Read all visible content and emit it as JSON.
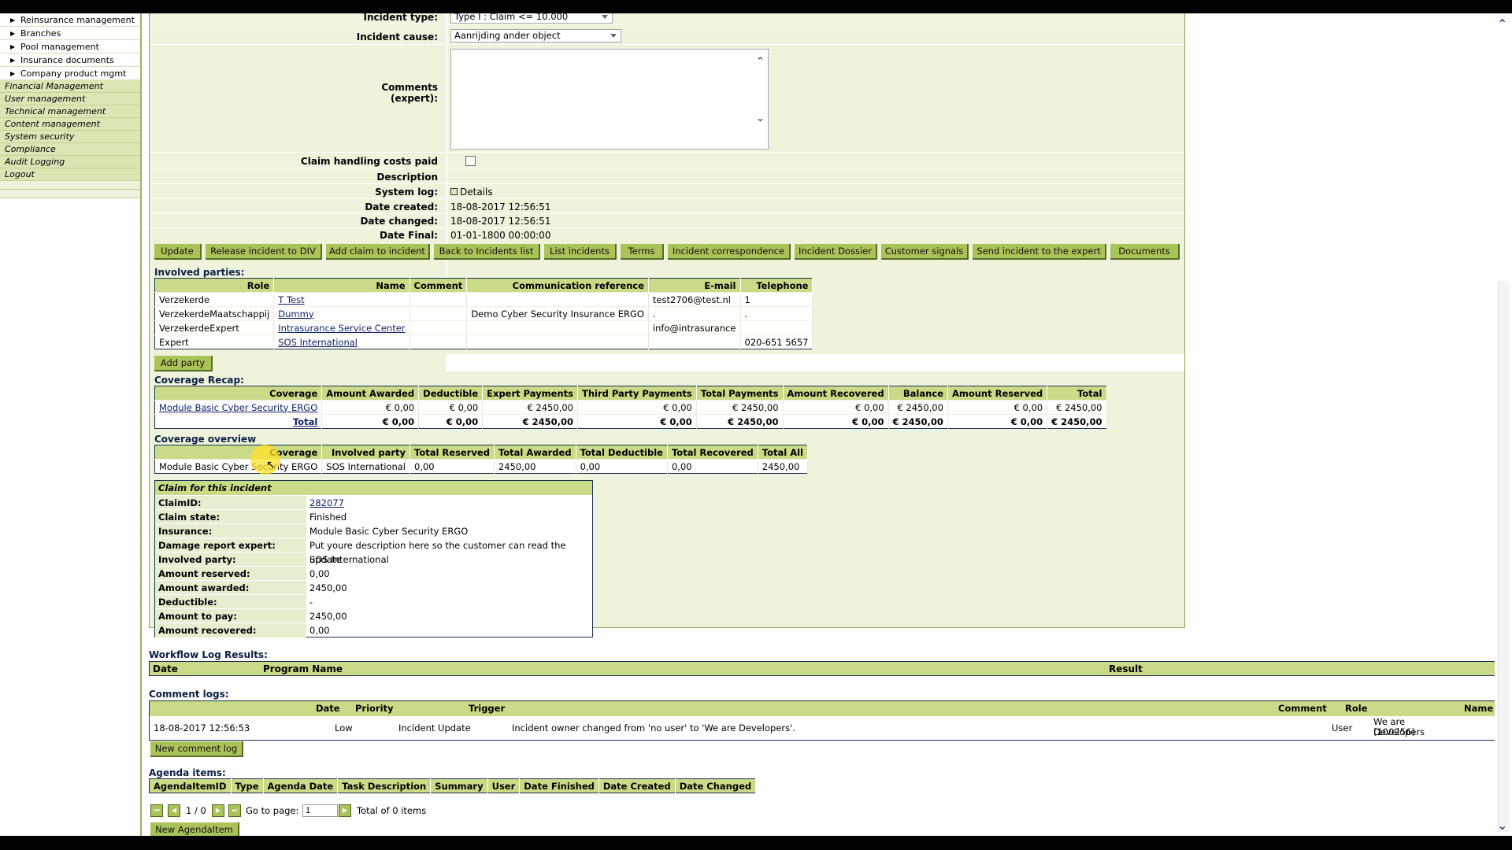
{
  "sidebar": {
    "sub_items": [
      "Reinsurance management",
      "Branches",
      "Pool management",
      "Insurance documents",
      "Company product mgmt"
    ],
    "main_items": [
      "Financial Management",
      "User management",
      "Technical management",
      "Content management",
      "System security",
      "Compliance",
      "Audit Logging",
      "Logout"
    ]
  },
  "form": {
    "incident_type_label": "Incident type:",
    "incident_type_value": "Type I : Claim <= 10.000",
    "incident_cause_label": "Incident cause:",
    "incident_cause_value": "Aanrijding ander object",
    "comments_label_1": "Comments",
    "comments_label_2": "(expert):",
    "claim_costs_label": "Claim handling costs paid",
    "description_label": "Description",
    "system_log_label": "System log:",
    "system_log_value": "Details",
    "date_created_label": "Date created:",
    "date_created_value": "18-08-2017 12:56:51",
    "date_changed_label": "Date changed:",
    "date_changed_value": "18-08-2017 12:56:51",
    "date_final_label": "Date Final:",
    "date_final_value": "01-01-1800 00:00:00"
  },
  "buttons": [
    "Update",
    "Release incident to DIV",
    "Add claim to incident",
    "Back to Incidents list",
    "List incidents",
    "Terms",
    "Incident correspondence",
    "Incident Dossier",
    "Customer signals",
    "Send incident to the expert",
    "Documents"
  ],
  "involved_parties": {
    "title": "Involved parties:",
    "headers": [
      "Role",
      "Name",
      "Comment",
      "Communication reference",
      "E-mail",
      "Telephone"
    ],
    "rows": [
      [
        "Verzekerde",
        "T Test",
        "",
        "",
        "test2706@test.nl",
        "1"
      ],
      [
        "VerzekerdeMaatschappij",
        "Dummy",
        "",
        "Demo Cyber Security Insurance ERGO",
        ".",
        "."
      ],
      [
        "VerzekerdeExpert",
        "Intrasurance Service Center",
        "",
        "",
        "info@intrasurance",
        ""
      ],
      [
        "Expert",
        "SOS International",
        "",
        "",
        "",
        "020-651 5657"
      ]
    ],
    "add_button": "Add party"
  },
  "coverage_recap": {
    "title": "Coverage Recap:",
    "headers": [
      "Coverage",
      "Amount Awarded",
      "Deductible",
      "Expert Payments",
      "Third Party Payments",
      "Total Payments",
      "Amount Recovered",
      "Balance",
      "Amount Reserved",
      "Total"
    ],
    "rows": [
      [
        "Module Basic Cyber Security ERGO",
        "€ 0,00",
        "€ 0,00",
        "€ 2450,00",
        "€ 0,00",
        "€ 2450,00",
        "€ 0,00",
        "€ 2450,00",
        "€ 0,00",
        "€ 2450,00"
      ]
    ],
    "total_row": [
      "Total",
      "€ 0,00",
      "€ 0,00",
      "€ 2450,00",
      "€ 0,00",
      "€ 2450,00",
      "€ 0,00",
      "€ 2450,00",
      "€ 0,00",
      "€ 2450,00"
    ]
  },
  "coverage_overview": {
    "title": "Coverage overview",
    "headers": [
      "Coverage",
      "Involved party",
      "Total Reserved",
      "Total Awarded",
      "Total Deductible",
      "Total Recovered",
      "Total All"
    ],
    "rows": [
      [
        "Module Basic Cyber Security ERGO",
        "SOS International",
        "0,00",
        "2450,00",
        "0,00",
        "0,00",
        "2450,00"
      ]
    ]
  },
  "claim": {
    "title": "Claim for this incident",
    "rows": [
      [
        "ClaimID:",
        "282077"
      ],
      [
        "Claim state:",
        "Finished"
      ],
      [
        "Insurance:",
        "Module Basic Cyber Security ERGO"
      ],
      [
        "Damage report expert:",
        "Put youre description here so the customer can read the update"
      ],
      [
        "Involved party:",
        "SOS International"
      ],
      [
        "Amount reserved:",
        "0,00"
      ],
      [
        "Amount awarded:",
        "2450,00"
      ],
      [
        "Deductible:",
        "-"
      ],
      [
        "Amount to pay:",
        "2450,00"
      ],
      [
        "Amount recovered:",
        "0,00"
      ]
    ]
  },
  "workflow": {
    "title": "Workflow Log Results:",
    "headers": [
      "Date",
      "Program Name",
      "Result"
    ]
  },
  "comment_logs": {
    "title": "Comment logs:",
    "headers": [
      "Date",
      "Priority",
      "Trigger",
      "Comment",
      "Role",
      "Name"
    ],
    "row": {
      "date": "18-08-2017 12:56:53",
      "priority": "Low",
      "trigger": "Incident Update",
      "comment": "Incident owner changed from 'no user' to 'We are Developers'.",
      "role": "User",
      "name_1": "We are Developers",
      "name_2": "(100256)"
    },
    "new_button": "New comment log"
  },
  "agenda": {
    "title": "Agenda items:",
    "headers": [
      "AgendaItemID",
      "Type",
      "Agenda Date",
      "Task Description",
      "Summary",
      "User",
      "Date Finished",
      "Date Created",
      "Date Changed"
    ],
    "page_display": "1 / 0",
    "go_to_label": "Go to page:",
    "page_input": "1",
    "total_label": "Total of 0 items",
    "new_button": "New AgendaItem"
  },
  "colors": {
    "panel": "#eef3dc",
    "header": "#c9db86",
    "button": "#a9c359",
    "border": "#1d2f55"
  }
}
